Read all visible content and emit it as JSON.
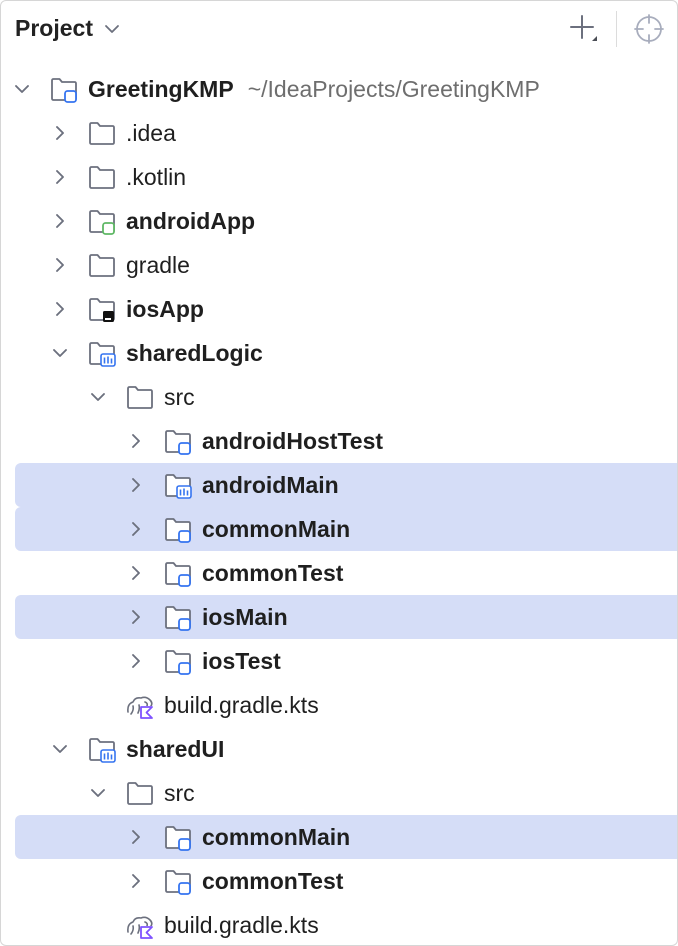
{
  "header": {
    "title": "Project"
  },
  "tree": [
    {
      "label": "GreetingKMP",
      "path": "~/IdeaProjects/GreetingKMP",
      "level": 0,
      "expanded": true,
      "hasArrow": true,
      "icon": "module-folder-icon",
      "bold": true
    },
    {
      "label": ".idea",
      "level": 1,
      "expanded": false,
      "hasArrow": true,
      "icon": "folder-icon",
      "bold": false
    },
    {
      "label": ".kotlin",
      "level": 1,
      "expanded": false,
      "hasArrow": true,
      "icon": "folder-icon",
      "bold": false
    },
    {
      "label": "androidApp",
      "level": 1,
      "expanded": false,
      "hasArrow": true,
      "icon": "android-module-folder-icon",
      "bold": true
    },
    {
      "label": "gradle",
      "level": 1,
      "expanded": false,
      "hasArrow": true,
      "icon": "folder-icon",
      "bold": false
    },
    {
      "label": "iosApp",
      "level": 1,
      "expanded": false,
      "hasArrow": true,
      "icon": "ios-module-folder-icon",
      "bold": true
    },
    {
      "label": "sharedLogic",
      "level": 1,
      "expanded": true,
      "hasArrow": true,
      "icon": "library-module-folder-icon",
      "bold": true
    },
    {
      "label": "src",
      "level": 2,
      "expanded": true,
      "hasArrow": true,
      "icon": "folder-icon",
      "bold": false
    },
    {
      "label": "androidHostTest",
      "level": 3,
      "expanded": false,
      "hasArrow": true,
      "icon": "source-set-folder-icon",
      "bold": true
    },
    {
      "label": "androidMain",
      "level": 3,
      "expanded": false,
      "hasArrow": true,
      "icon": "library-source-set-folder-icon",
      "bold": true,
      "selected": true
    },
    {
      "label": "commonMain",
      "level": 3,
      "expanded": false,
      "hasArrow": true,
      "icon": "source-set-folder-icon",
      "bold": true,
      "selected": true
    },
    {
      "label": "commonTest",
      "level": 3,
      "expanded": false,
      "hasArrow": true,
      "icon": "source-set-folder-icon",
      "bold": true
    },
    {
      "label": "iosMain",
      "level": 3,
      "expanded": false,
      "hasArrow": true,
      "icon": "source-set-folder-icon",
      "bold": true,
      "selected": true
    },
    {
      "label": "iosTest",
      "level": 3,
      "expanded": false,
      "hasArrow": true,
      "icon": "source-set-folder-icon",
      "bold": true
    },
    {
      "label": "build.gradle.kts",
      "level": 2,
      "hasArrow": false,
      "icon": "gradle-kotlin-file-icon",
      "bold": false
    },
    {
      "label": "sharedUI",
      "level": 1,
      "expanded": true,
      "hasArrow": true,
      "icon": "library-module-folder-icon",
      "bold": true
    },
    {
      "label": "src",
      "level": 2,
      "expanded": true,
      "hasArrow": true,
      "icon": "folder-icon",
      "bold": false
    },
    {
      "label": "commonMain",
      "level": 3,
      "expanded": false,
      "hasArrow": true,
      "icon": "source-set-folder-icon",
      "bold": true,
      "selected": true
    },
    {
      "label": "commonTest",
      "level": 3,
      "expanded": false,
      "hasArrow": true,
      "icon": "source-set-folder-icon",
      "bold": true
    },
    {
      "label": "build.gradle.kts",
      "level": 2,
      "hasArrow": false,
      "icon": "gradle-kotlin-file-icon",
      "bold": false
    }
  ],
  "colors": {
    "selection": "#d5ddf7",
    "blue_badge": "#3574f0",
    "green_badge": "#5fb865",
    "purple_kotlin": "#7f52ff",
    "icon_stroke": "#6c707e"
  }
}
